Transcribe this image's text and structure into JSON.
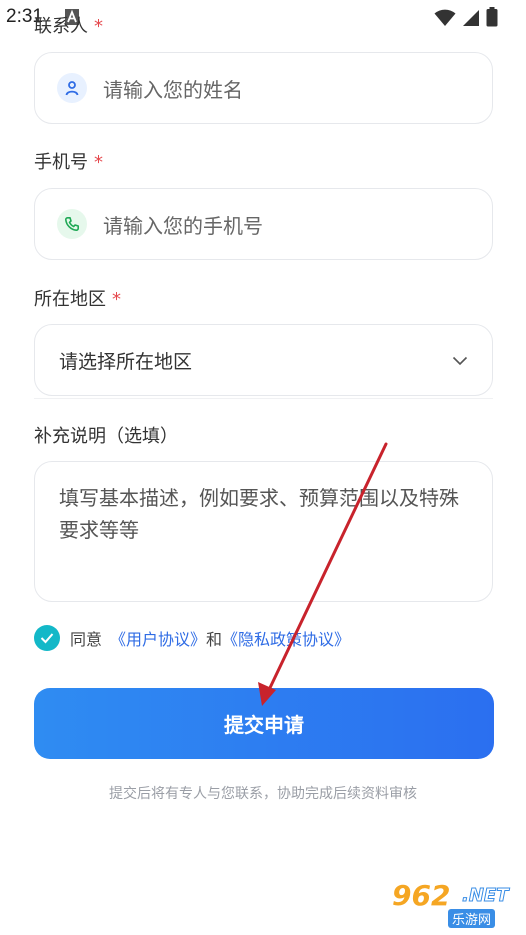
{
  "statusbar": {
    "time": "2:31"
  },
  "contact": {
    "label": "联系人",
    "required_mark": "*",
    "placeholder": "请输入您的姓名",
    "icon": "user-icon"
  },
  "phone": {
    "label": "手机号",
    "required_mark": "*",
    "placeholder": "请输入您的手机号",
    "icon": "phone-icon"
  },
  "region": {
    "label": "所在地区",
    "required_mark": "*",
    "value": "请选择所在地区",
    "icon": "chevron-down-icon"
  },
  "notes": {
    "label": "补充说明（选填）",
    "placeholder": "填写基本描述，例如要求、预算范围以及特殊要求等等"
  },
  "agreement": {
    "prefix": "同意",
    "user_agreement": "《用户协议》",
    "and": "和",
    "privacy_policy": "《隐私政策协议》",
    "checked": true
  },
  "submit_label": "提交申请",
  "footer_note": "提交后将有专人与您联系，协助完成后续资料审核",
  "watermark": {
    "number": "962",
    "domain": ".NET",
    "name": "乐游网"
  },
  "colors": {
    "accent": "#2b6ff0",
    "check": "#13b8c8",
    "required": "#e5484d",
    "link": "#2f6ce5",
    "arrow": "#c8232c"
  }
}
